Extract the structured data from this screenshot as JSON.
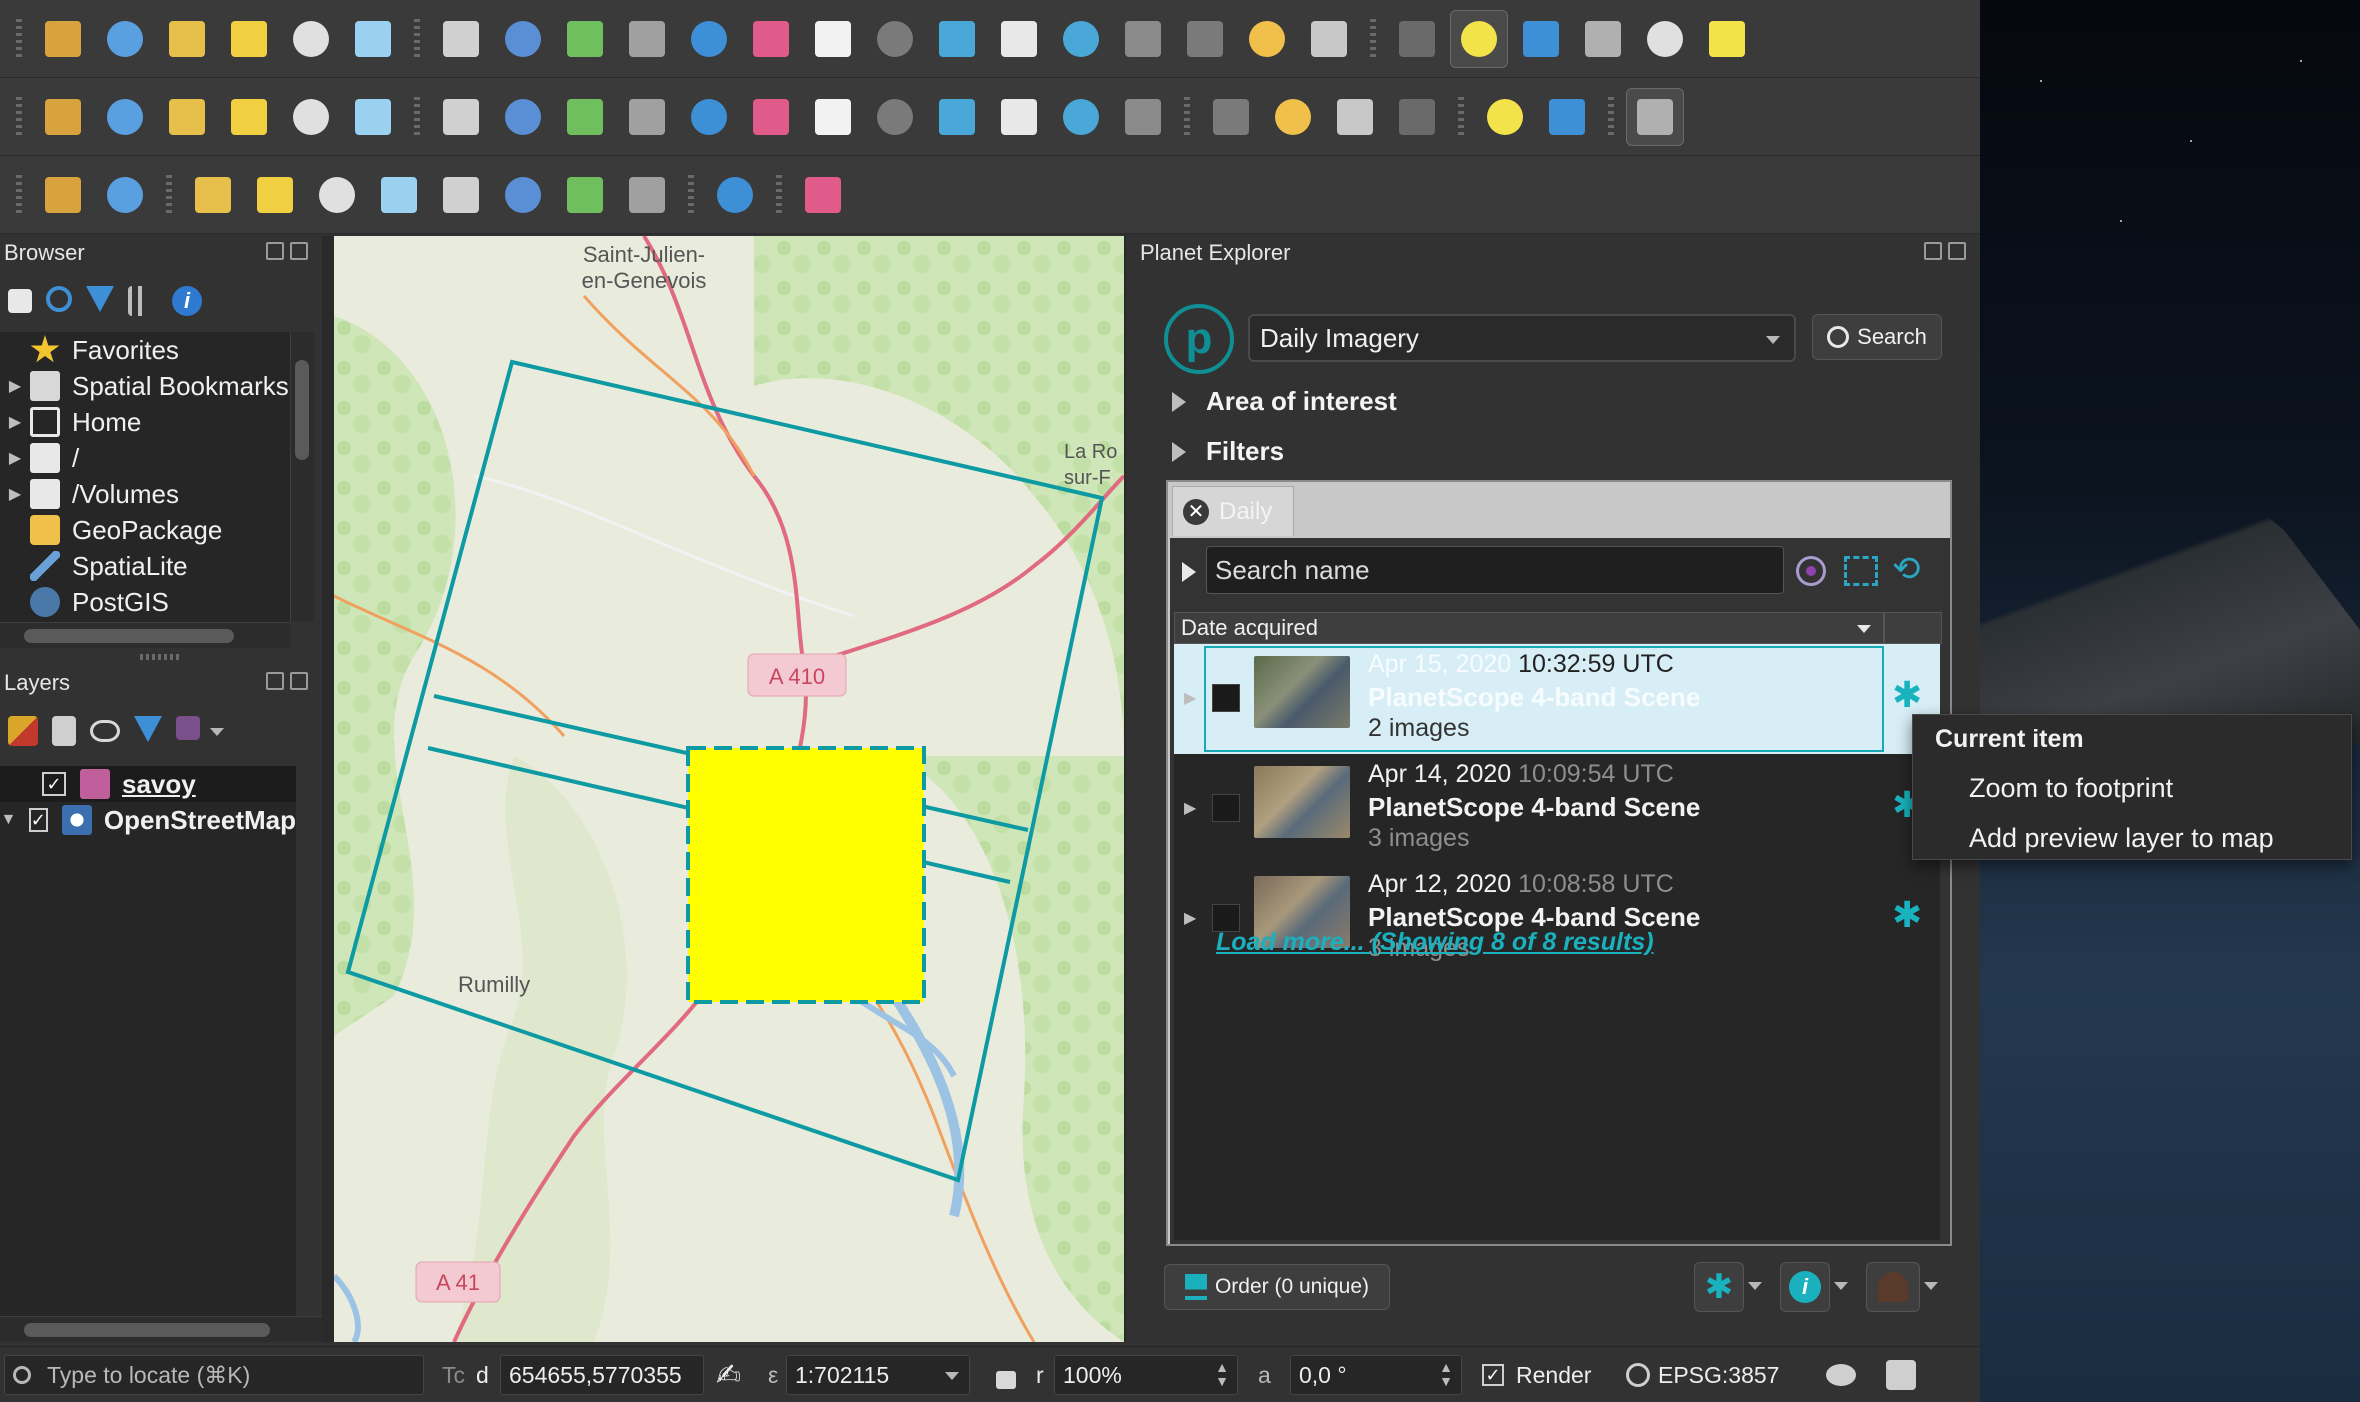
{
  "colors": {
    "accent": "#0f8f94",
    "aoi_fill": "#ffff00",
    "footprint_stroke": "#0e9aa3",
    "selection_bg": "#d7eef6",
    "link": "#1ab0bd",
    "layer_savoy": "#c05f9c"
  },
  "toolbars": {
    "row1_icons": [
      "new-project-icon",
      "open-project-icon",
      "save-project-icon",
      "save-as-icon",
      "print-layout-icon",
      "layout-manager-icon",
      "pan-icon",
      "pan-to-selection-icon",
      "zoom-in-icon",
      "zoom-out-icon",
      "zoom-full-icon",
      "zoom-to-selection-icon",
      "zoom-to-layer-icon",
      "zoom-native-icon",
      "zoom-last-icon",
      "zoom-next-icon",
      "new-bookmark-icon",
      "show-bookmarks-icon",
      "new-map-view-icon",
      "refresh-icon",
      "identify-icon",
      "run-action-icon",
      "select-features-icon",
      "measure-icon",
      "deselect-icon",
      "attribute-table-icon",
      "statistics-icon"
    ],
    "row2_icons": [
      "data-source-manager-icon",
      "new-geopackage-icon",
      "new-temp-layer-icon",
      "digitize-icon",
      "save-edits-icon",
      "vertex-tool-icon",
      "toggle-editing-icon",
      "pencil-icon",
      "save-layer-edits-icon",
      "add-polygon-icon",
      "move-feature-icon",
      "node-tool-icon",
      "delete-selected-icon",
      "cut-icon",
      "copy-icon",
      "paste-icon",
      "undo-icon",
      "redo-icon",
      "label-icon",
      "diagram-icon",
      "pin-label-icon",
      "highlight-label-icon",
      "georeference-icon",
      "python-console-icon",
      "help-icon"
    ],
    "row3_icons": [
      "locator-icon",
      "gps-icon",
      "terrain-1-icon",
      "terrain-2-icon",
      "terrain-3-icon",
      "terrain-4-icon",
      "sun-1-icon",
      "sun-2-icon",
      "moon-1-icon",
      "moon-2-icon",
      "profile-tool-icon",
      "planet-icon"
    ]
  },
  "browser": {
    "title": "Browser",
    "items": [
      {
        "label": "Favorites",
        "icon": "star-icon"
      },
      {
        "label": "Spatial Bookmarks",
        "icon": "bookmark-icon"
      },
      {
        "label": "Home",
        "icon": "home-icon"
      },
      {
        "label": "/",
        "icon": "folder-icon"
      },
      {
        "label": "/Volumes",
        "icon": "folder-icon"
      },
      {
        "label": "GeoPackage",
        "icon": "geopackage-icon"
      },
      {
        "label": "SpatiaLite",
        "icon": "spatialite-icon"
      },
      {
        "label": "PostGIS",
        "icon": "postgis-icon"
      }
    ]
  },
  "layers": {
    "title": "Layers",
    "items": [
      {
        "label": "savoy",
        "checked": true
      },
      {
        "label": "OpenStreetMap",
        "checked": true
      }
    ]
  },
  "map": {
    "labels": {
      "saint_julien_1": "Saint-Julien-",
      "saint_julien_2": "en-Genevois",
      "la_roche_1": "La Ro",
      "la_roche_2": "sur-F",
      "a410": "A 410",
      "rumilly": "Rumilly",
      "a41": "A 41"
    }
  },
  "planet": {
    "title": "Planet Explorer",
    "logo_letter": "p",
    "imagery_type": "Daily Imagery",
    "search_label": "Search",
    "area_of_interest": "Area of interest",
    "filters": "Filters",
    "tab_label": "Daily",
    "search_placeholder": "Search name",
    "sort_label": "Date acquired",
    "results": [
      {
        "date": "Apr 15, 2020",
        "time": "10:32:59 UTC",
        "title": "PlanetScope 4-band Scene",
        "count": "2 images",
        "selected": true
      },
      {
        "date": "Apr 14, 2020",
        "time": "10:09:54 UTC",
        "title": "PlanetScope 4-band Scene",
        "count": "3 images",
        "selected": false
      },
      {
        "date": "Apr 12, 2020",
        "time": "10:08:58 UTC",
        "title": "PlanetScope 4-band Scene",
        "count": "3 images",
        "selected": false
      }
    ],
    "load_more": "Load more... (Showing 8 of 8 results)",
    "order_label": "Order (0 unique)"
  },
  "context_menu": {
    "header": "Current item",
    "items": [
      "Zoom to footprint",
      "Add preview layer to map"
    ]
  },
  "status": {
    "locate_placeholder": "Type to locate (⌘K)",
    "coord_prefix": "d",
    "coordinate": "654655,5770355",
    "scale_prefix": "ε",
    "scale": "1:702115",
    "mag_prefix": "r",
    "magnifier": "100%",
    "rot_prefix": "a",
    "rotation": "0,0 °",
    "render_label": "Render",
    "crs": "EPSG:3857",
    "coord_label_prefix": "Tc"
  }
}
